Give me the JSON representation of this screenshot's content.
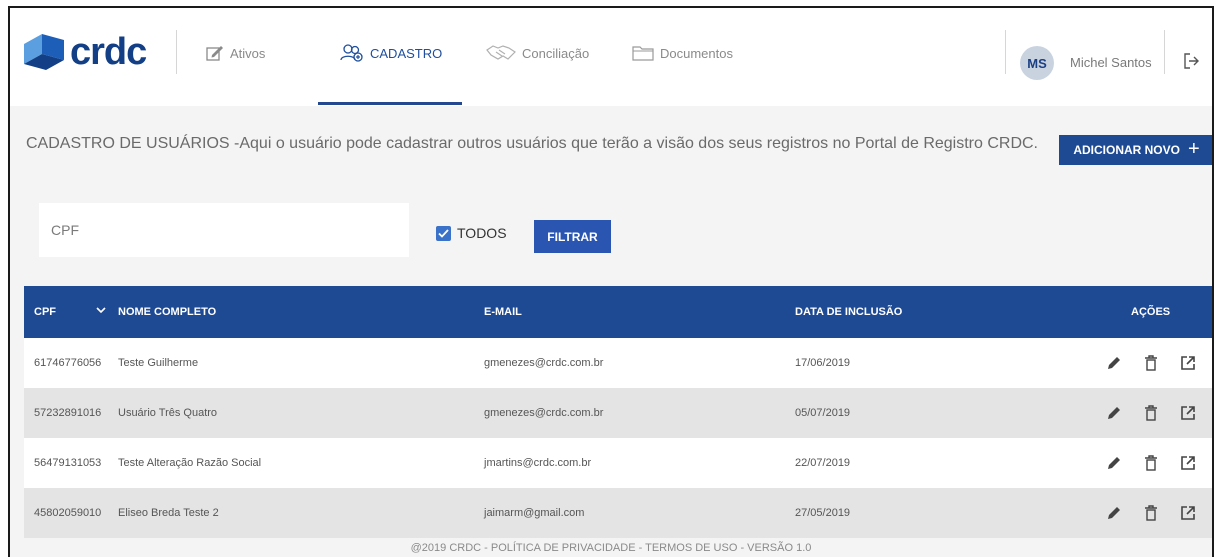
{
  "brand": {
    "logo_text": "crdc"
  },
  "nav": [
    {
      "label": "Ativos",
      "icon": "edit-box-icon",
      "active": false
    },
    {
      "label": "CADASTRO",
      "icon": "users-icon",
      "active": true
    },
    {
      "label": "Conciliação",
      "icon": "handshake-icon",
      "active": false
    },
    {
      "label": "Documentos",
      "icon": "folder-icon",
      "active": false
    }
  ],
  "user": {
    "initials": "MS",
    "name": "Michel Santos"
  },
  "page": {
    "description": "CADASTRO DE USUÁRIOS -Aqui o usuário pode cadastrar outros usuários que terão a visão dos seus registros no Portal de Registro CRDC.",
    "add_button": "ADICIONAR NOVO",
    "add_icon": "+"
  },
  "filters": {
    "cpf_placeholder": "CPF",
    "checkbox_label": "TODOS",
    "checkbox_checked": true,
    "filter_button": "FILTRAR"
  },
  "table": {
    "columns": [
      "CPF",
      "NOME COMPLETO",
      "E-MAIL",
      "DATA DE INCLUSÃO",
      "AÇÕES"
    ],
    "rows": [
      {
        "cpf": "61746776056",
        "nome": "Teste Guilherme",
        "email": "gmenezes@crdc.com.br",
        "data": "17/06/2019"
      },
      {
        "cpf": "57232891016",
        "nome": "Usuário Três Quatro",
        "email": "gmenezes@crdc.com.br",
        "data": "05/07/2019"
      },
      {
        "cpf": "56479131053",
        "nome": "Teste Alteração Razão Social",
        "email": "jmartins@crdc.com.br",
        "data": "22/07/2019"
      },
      {
        "cpf": "45802059010",
        "nome": "Eliseo Breda Teste 2",
        "email": "jaimarm@gmail.com",
        "data": "27/05/2019"
      }
    ]
  },
  "footer": {
    "text": "@2019 CRDC - POLÍTICA DE PRIVACIDADE - TERMOS DE USO - VERSÃO 1.0"
  },
  "colors": {
    "primary": "#1e4a94",
    "accent": "#2a55b0",
    "logo_light": "#5b9fe0",
    "logo_dark": "#123f85"
  }
}
